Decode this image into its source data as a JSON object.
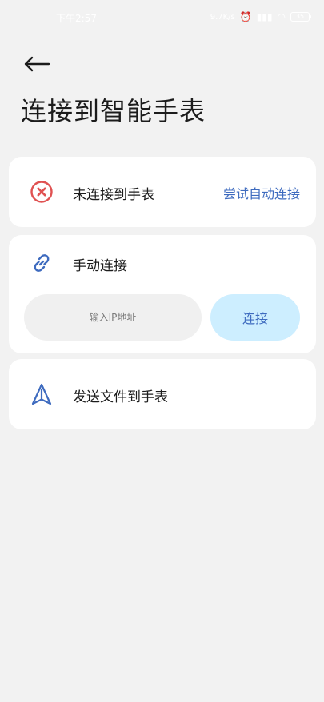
{
  "status_bar": {
    "time": "下午2:57",
    "network_speed": "9.7K/s",
    "battery": "35"
  },
  "header": {
    "title": "连接到智能手表"
  },
  "status_card": {
    "status_text": "未连接到手表",
    "retry_label": "尝试自动连接",
    "icon": "close-circle-icon",
    "icon_color": "#e05252"
  },
  "manual_card": {
    "title": "手动连接",
    "icon": "link-icon",
    "ip_input": {
      "value": "",
      "placeholder": "输入IP地址"
    },
    "connect_label": "连接"
  },
  "send_card": {
    "title": "发送文件到手表",
    "icon": "send-icon"
  },
  "colors": {
    "accent": "#3e6bbf",
    "button_bg": "#cdeeff",
    "page_bg": "#f2f2f2",
    "card_bg": "#ffffff"
  }
}
